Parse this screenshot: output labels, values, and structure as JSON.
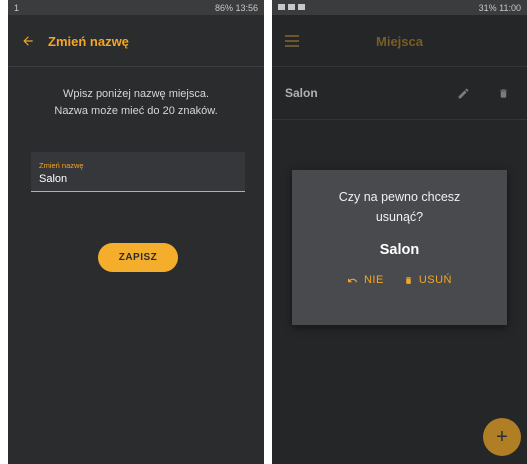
{
  "left": {
    "status": {
      "left": "1",
      "right": "86% 13:56"
    },
    "appbar": {
      "title": "Zmień nazwę"
    },
    "description": {
      "line1": "Wpisz poniżej nazwę miejsca.",
      "line2": "Nazwa może mieć do 20 znaków."
    },
    "input": {
      "label": "Zmień nazwę",
      "value": "Salon"
    },
    "save_button": "ZAPISZ"
  },
  "right": {
    "status": {
      "right": "31% 11:00"
    },
    "appbar": {
      "title": "Miejsca"
    },
    "list": [
      {
        "name": "Salon"
      }
    ],
    "dialog": {
      "question": "Czy na pewno chcesz usunąć?",
      "place": "Salon",
      "cancel": "NIE",
      "confirm": "USUŃ"
    },
    "fab_label": "+"
  },
  "colors": {
    "accent": "#f5a623",
    "background": "#2a2c2e",
    "dialog": "#484a4d"
  }
}
